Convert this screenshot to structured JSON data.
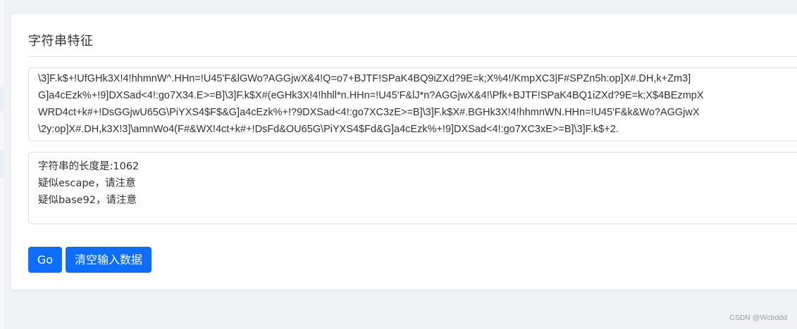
{
  "card": {
    "title": "字符串特征"
  },
  "input": {
    "lines": [
      "\\3]F.k$+!UfGHk3X!4!hhmnW^.HHn=!U45'F&lGWo?AGGjwX&4!Q=o7+BJTF!SPaK4BQ9iZXd?9E=k;X%4!/KmpXC3|F#SPZn5h:op]X#.DH,k+Zm3]",
      "G]a4cEzk%+!9]DXSad<4!:go7X34.E>=B]\\3]F.k$X#(eGHk3X!4!hhll*n.HHn=!U45'F&lJ*n?AGGjwX&4!\\Pfk+BJTF!SPaK4BQ1iZXd?9E=k;X$4BEzmpX",
      "WRD4ct+k#+!DsGGjwU65G\\PiYXS4$F$&G]a4cEzk%+!?9DXSad<4!:go7XC3zE>=B]\\3]F.k$X#.BGHk3X!4!hhmnWN.HHn=!U45'F&k&Wo?AGGjwX",
      "\\2y:op]X#.DH,k3X!3]\\amnWo4(F#&WX!4ct+k#+!DsFd&OU65G\\PiYXS4$Fd&G]a4cEzk%+!9]DXSad<4!:go7XC3xE>=B]\\3]F.k$+2."
    ]
  },
  "output": {
    "lines": [
      "字符串的长度是:1062",
      "疑似escape，请注意",
      "疑似base92，请注意"
    ]
  },
  "buttons": {
    "go_label": "Go",
    "clear_label": "清空输入数据"
  },
  "watermark": "CSDN @Wcbddd"
}
